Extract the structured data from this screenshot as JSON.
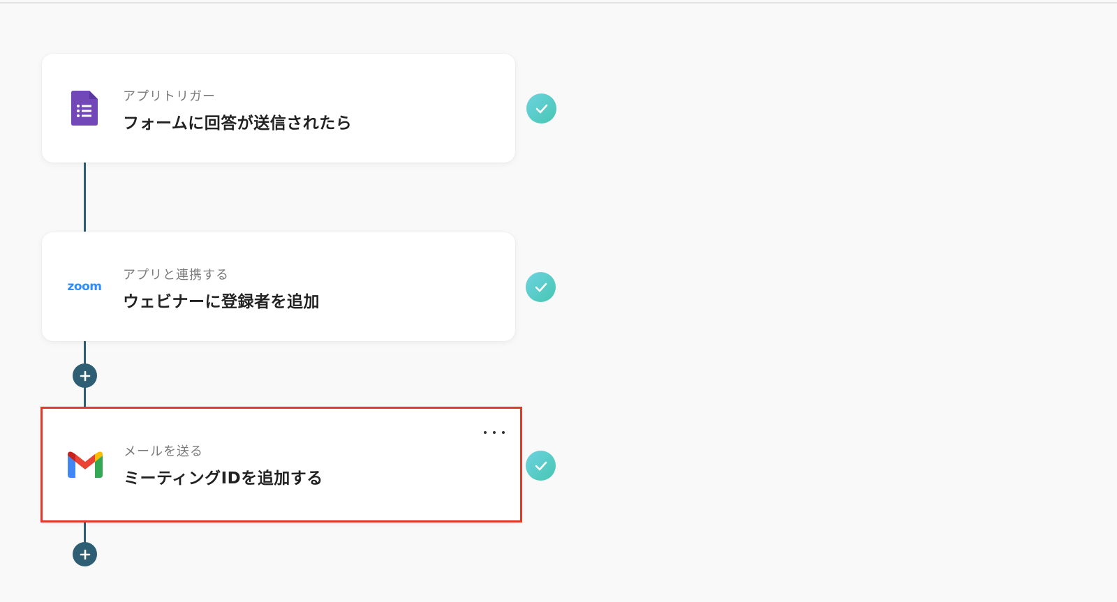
{
  "flow": {
    "steps": [
      {
        "label": "アプリトリガー",
        "title": "フォームに回答が送信されたら",
        "icon": "google-forms-icon",
        "status": "completed"
      },
      {
        "label": "アプリと連携する",
        "title": "ウェビナーに登録者を追加",
        "icon": "zoom-icon",
        "icon_text": "zoom",
        "status": "completed"
      },
      {
        "label": "メールを送る",
        "title": "ミーティングIDを追加する",
        "icon": "gmail-icon",
        "status": "completed",
        "highlighted": true
      }
    ],
    "add_step_icon": "plus-icon",
    "more_options_icon": "more-horizontal-icon",
    "colors": {
      "connector": "#2e5e74",
      "check_badge": "#4fcabf",
      "highlight": "#e03a2a",
      "forms_purple": "#7248b9",
      "zoom_blue": "#2d8cff"
    }
  }
}
